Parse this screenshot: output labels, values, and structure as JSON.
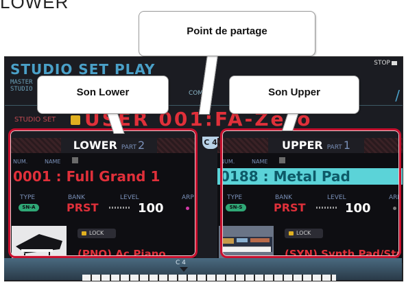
{
  "top_fragment": "LOWER",
  "callouts": {
    "split_point": "Point de partage",
    "lower_sound": "Son Lower",
    "upper_sound": "Son Upper"
  },
  "screen": {
    "title": "STUDIO SET PLAY",
    "sub1": "MASTER",
    "sub2": "STUDIO",
    "comp": "COMP",
    "stop": "STOP",
    "right_glyph": "/",
    "studio_set_label": "STUDIO SET",
    "studio_set_name": "USER  001:FA-Zero",
    "split_badge": "C 4",
    "keyboard_label": "C 4"
  },
  "lower": {
    "name": "LOWER",
    "part_label": "PART",
    "part_number": "2",
    "num_label": "NUM.",
    "name_label": "NAME",
    "tone": "0001 : Full Grand 1",
    "type_label": "TYPE",
    "bank_label": "BANK",
    "level_label": "LEVEL",
    "arp_label": "ARP",
    "type_badge": "SN-A",
    "bank": "PRST",
    "level": "100",
    "lock": "LOCK",
    "category": "(PNO) Ac.Piano"
  },
  "upper": {
    "name": "UPPER",
    "part_label": "PART",
    "part_number": "1",
    "num_label": "NUM.",
    "name_label": "NAME",
    "tone": "0188 : Metal Pad",
    "type_label": "TYPE",
    "bank_label": "BANK",
    "level_label": "LEVEL",
    "arp_label": "ARP",
    "type_badge": "SN-S",
    "bank": "PRST",
    "level": "100",
    "lock": "LOCK",
    "category": "(SYN) Synth Pad/Str"
  },
  "colors": {
    "frame": "#c8102e",
    "highlight": "#5bd3d8",
    "accent_red": "#e0303a",
    "screen_bg": "#1b1c22"
  }
}
